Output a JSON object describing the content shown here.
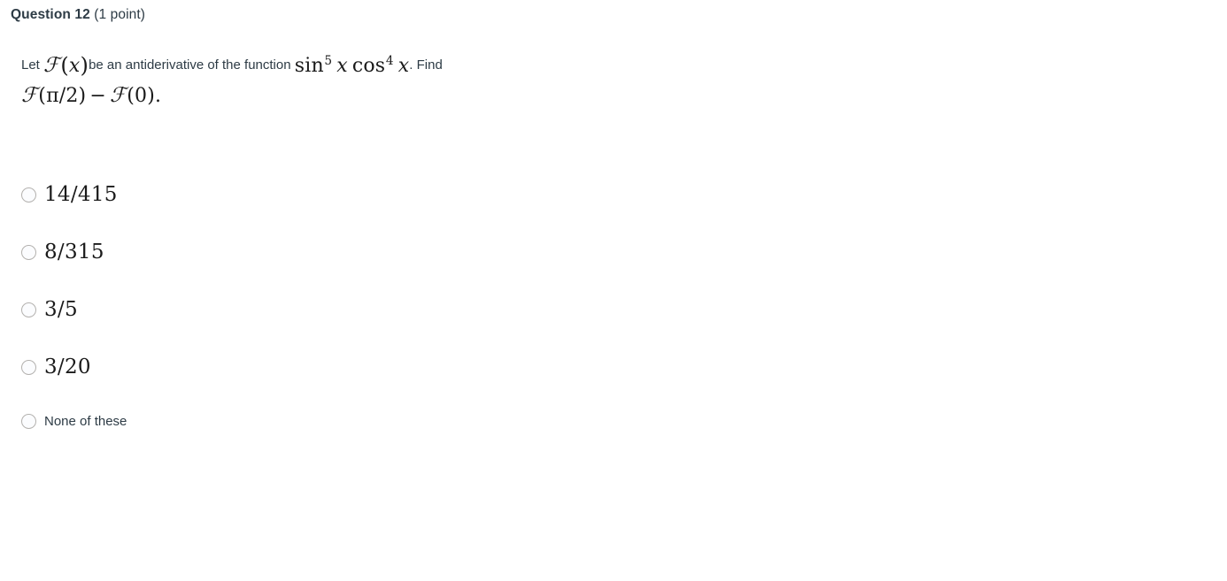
{
  "header": {
    "question_label": "Question 12",
    "points": " (1 point)"
  },
  "question": {
    "intro_text": "Let",
    "func_symbol_F": "ℱ",
    "func_open": "(",
    "func_var": "x",
    "func_close": ")",
    "middle_text": "be an antiderivative of the function",
    "integrand_sin": "sin",
    "integrand_sin_exp": "5",
    "integrand_var1": "x",
    "integrand_cos": "cos",
    "integrand_cos_exp": "4",
    "integrand_var2": "x",
    "after_text": ". Find",
    "line2_F1": "ℱ",
    "line2_arg1": "(π/2)",
    "line2_minus": "−",
    "line2_F2": "ℱ",
    "line2_arg2": "(0)",
    "line2_period": "."
  },
  "options": [
    {
      "id": "option-a",
      "label": "14/415",
      "style": "math",
      "selected": false
    },
    {
      "id": "option-b",
      "label": "8/315",
      "style": "math",
      "selected": false
    },
    {
      "id": "option-c",
      "label": "3/5",
      "style": "math",
      "selected": false
    },
    {
      "id": "option-d",
      "label": "3/20",
      "style": "math",
      "selected": false
    },
    {
      "id": "option-e",
      "label": "None of these",
      "style": "text",
      "selected": false
    }
  ],
  "colors": {
    "text": "#2d3b45",
    "math": "#1a1a1a",
    "radio_border": "#b3b1ae",
    "radio_fill": "#fbfcfe",
    "background": "#ffffff"
  }
}
